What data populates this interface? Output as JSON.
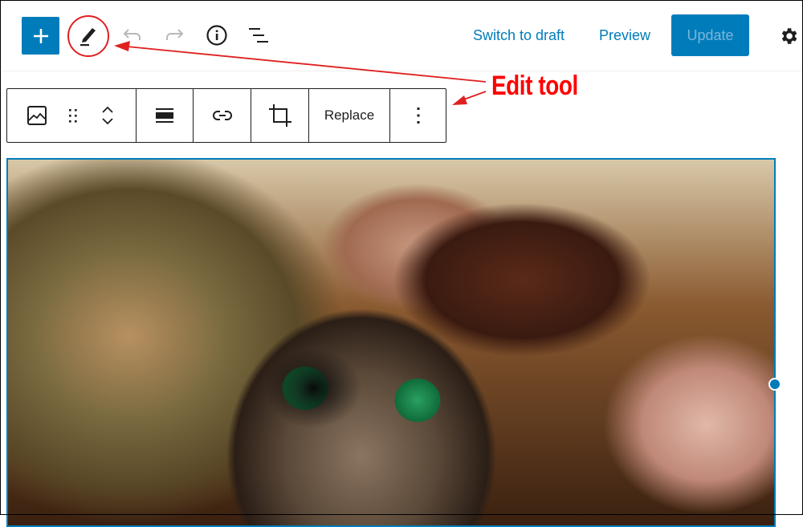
{
  "header": {
    "add_block_label": "+",
    "icons": [
      "plus-icon",
      "pencil-edit-icon",
      "undo-icon",
      "redo-icon",
      "info-icon",
      "list-view-icon"
    ],
    "switch_to_draft_label": "Switch to draft",
    "preview_label": "Preview",
    "update_label": "Update",
    "settings_icon": "gear-icon"
  },
  "block_toolbar": {
    "groups": [
      {
        "items": [
          "image-icon",
          "drag-handle-icon",
          "move-up-down-icon"
        ]
      },
      {
        "items": [
          "align-wide-icon"
        ]
      },
      {
        "items": [
          "link-icon"
        ]
      },
      {
        "items": [
          "crop-icon"
        ]
      },
      {
        "items": [
          "replace"
        ]
      },
      {
        "items": [
          "more-options-icon"
        ]
      }
    ],
    "replace_label": "Replace"
  },
  "image_block": {
    "subject": "kitten with green eyes under a shaggy rug",
    "selected": true
  },
  "annotation": {
    "text": "Edit tool",
    "color": "#ff0000"
  },
  "colors": {
    "accent": "#007cba",
    "update_text": "#7ab7dc",
    "annotation": "#ff0000"
  }
}
